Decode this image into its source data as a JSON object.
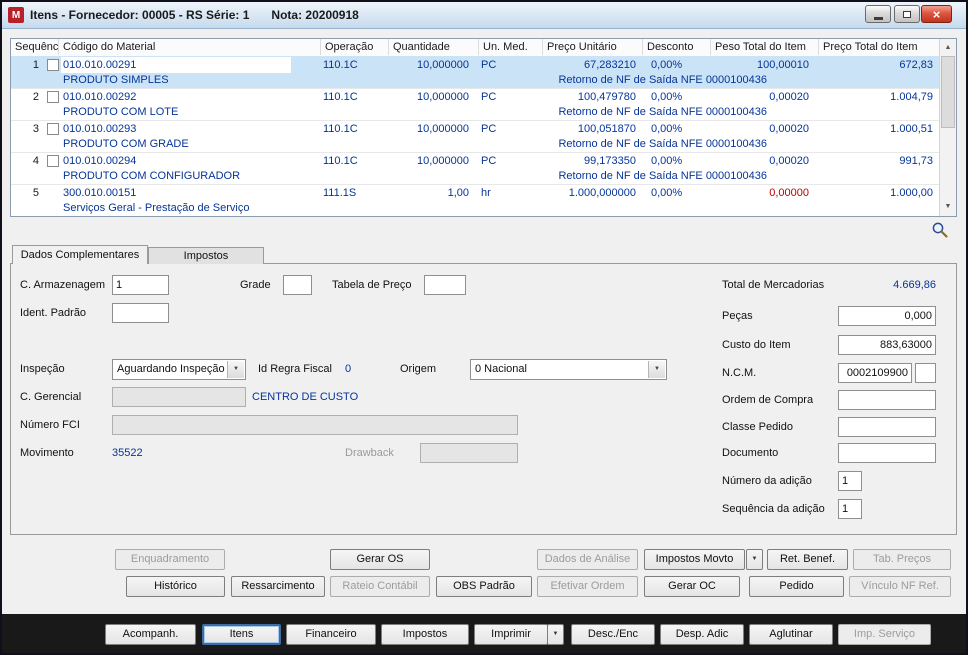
{
  "window": {
    "title_left": "Itens - Fornecedor: 00005 - RS Série: 1",
    "title_right": "Nota: 20200918"
  },
  "colors": {
    "navy_text": "#063598",
    "alert_red": "#C00000",
    "selection_blue": "#CBE3F6",
    "titlebar_blue": "#D8E6F3",
    "close_red": "#C13420",
    "bottom_bar_dark": "#191919"
  },
  "icons": {
    "app_logo": "M",
    "close": "×",
    "dropdown_arrow": "▼",
    "scroll_up": "▲",
    "scroll_down": "▼"
  },
  "grid": {
    "columns": [
      "Sequência",
      "Código do Material",
      "Operação",
      "Quantidade",
      "Un. Med.",
      "Preço Unitário",
      "Desconto",
      "Peso Total do Item",
      "Preço Total do Item"
    ],
    "rows": [
      {
        "seq": "1",
        "code": "010.010.00291",
        "desc": "PRODUTO SIMPLES",
        "op": "110.1C",
        "qty": "10,000000",
        "um": "PC",
        "unit_price": "67,283210",
        "discount": "0,00%",
        "weight": "100,00010",
        "total": "672,83",
        "note": "Retorno de NF de Saída NFE  0000100436"
      },
      {
        "seq": "2",
        "code": "010.010.00292",
        "desc": "PRODUTO COM LOTE",
        "op": "110.1C",
        "qty": "10,000000",
        "um": "PC",
        "unit_price": "100,479780",
        "discount": "0,00%",
        "weight": "0,00020",
        "total": "1.004,79",
        "note": "Retorno de NF de Saída NFE  0000100436"
      },
      {
        "seq": "3",
        "code": "010.010.00293",
        "desc": "PRODUTO COM GRADE",
        "op": "110.1C",
        "qty": "10,000000",
        "um": "PC",
        "unit_price": "100,051870",
        "discount": "0,00%",
        "weight": "0,00020",
        "total": "1.000,51",
        "note": "Retorno de NF de Saída NFE  0000100436"
      },
      {
        "seq": "4",
        "code": "010.010.00294",
        "desc": "PRODUTO COM CONFIGURADOR",
        "op": "110.1C",
        "qty": "10,000000",
        "um": "PC",
        "unit_price": "99,173350",
        "discount": "0,00%",
        "weight": "0,00020",
        "total": "991,73",
        "note": "Retorno de NF de Saída NFE  0000100436"
      },
      {
        "seq": "5",
        "code": "300.010.00151",
        "desc": "Serviços Geral - Prestação de Serviço",
        "op": "111.1S",
        "qty": "1,00",
        "um": "hr",
        "unit_price": "1.000,000000",
        "discount": "0,00%",
        "weight": "0,00000",
        "total": "1.000,00",
        "note": ""
      }
    ]
  },
  "tabs": {
    "dados_complementares": "Dados Complementares",
    "impostos": "Impostos"
  },
  "form": {
    "c_armazenagem": {
      "label": "C. Armazenagem",
      "value": "1"
    },
    "grade": {
      "label": "Grade",
      "value": ""
    },
    "tabela_preco": {
      "label": "Tabela de Preço",
      "value": ""
    },
    "ident_padrao": {
      "label": "Ident. Padrão",
      "value": ""
    },
    "inspecao": {
      "label": "Inspeção",
      "value": "Aguardando Inspeção"
    },
    "id_regra_fiscal": {
      "label": "Id Regra Fiscal",
      "value": "0"
    },
    "origem": {
      "label": "Origem",
      "value": "0 Nacional"
    },
    "c_gerencial": {
      "label": "C. Gerencial",
      "value": "",
      "link": "CENTRO DE CUSTO"
    },
    "numero_fci": {
      "label": "Número FCI",
      "value": ""
    },
    "movimento": {
      "label": "Movimento",
      "value": "35522"
    },
    "drawback": {
      "label": "Drawback",
      "value": ""
    },
    "total_mercadorias": {
      "label": "Total de Mercadorias",
      "value": "4.669,86"
    },
    "pecas": {
      "label": "Peças",
      "value": "0,000"
    },
    "custo_item": {
      "label": "Custo do Item",
      "value": "883,63000"
    },
    "ncm": {
      "label": "N.C.M.",
      "value": "0002109900",
      "value2": ""
    },
    "ordem_compra": {
      "label": "Ordem de Compra",
      "value": ""
    },
    "classe_pedido": {
      "label": "Classe Pedido",
      "value": ""
    },
    "documento": {
      "label": "Documento",
      "value": ""
    },
    "numero_adicao": {
      "label": "Número da adição",
      "value": "1"
    },
    "sequencia_adicao": {
      "label": "Sequência da adição",
      "value": "1"
    }
  },
  "actions": {
    "row1": [
      {
        "label": "Enquadramento",
        "disabled": true
      },
      {
        "label": "Gerar OS",
        "disabled": false
      },
      {
        "label": "Dados de Análise",
        "disabled": true
      },
      {
        "label": "Impostos Movto",
        "disabled": false,
        "has_dropdown": true
      },
      {
        "label": "Ret. Benef.",
        "disabled": false
      },
      {
        "label": "Tab. Preços",
        "disabled": true
      }
    ],
    "row2": [
      {
        "label": "Histórico",
        "disabled": false
      },
      {
        "label": "Ressarcimento",
        "disabled": false
      },
      {
        "label": "Rateio Contábil",
        "disabled": true
      },
      {
        "label": "OBS Padrão",
        "disabled": false
      },
      {
        "label": "Efetivar Ordem",
        "disabled": true
      },
      {
        "label": "Gerar OC",
        "disabled": false
      },
      {
        "label": "Pedido",
        "disabled": false
      },
      {
        "label": "Vínculo NF Ref.",
        "disabled": true
      }
    ]
  },
  "bottom_bar": [
    {
      "label": "Acompanh.",
      "disabled": false
    },
    {
      "label": "Itens",
      "disabled": false,
      "active": true
    },
    {
      "label": "Financeiro",
      "disabled": false
    },
    {
      "label": "Impostos",
      "disabled": false
    },
    {
      "label": "Imprimir",
      "disabled": false,
      "has_dropdown": true
    },
    {
      "label": "Desc./Enc",
      "disabled": false
    },
    {
      "label": "Desp. Adic",
      "disabled": false
    },
    {
      "label": "Aglutinar",
      "disabled": false
    },
    {
      "label": "Imp. Serviço",
      "disabled": true
    }
  ]
}
